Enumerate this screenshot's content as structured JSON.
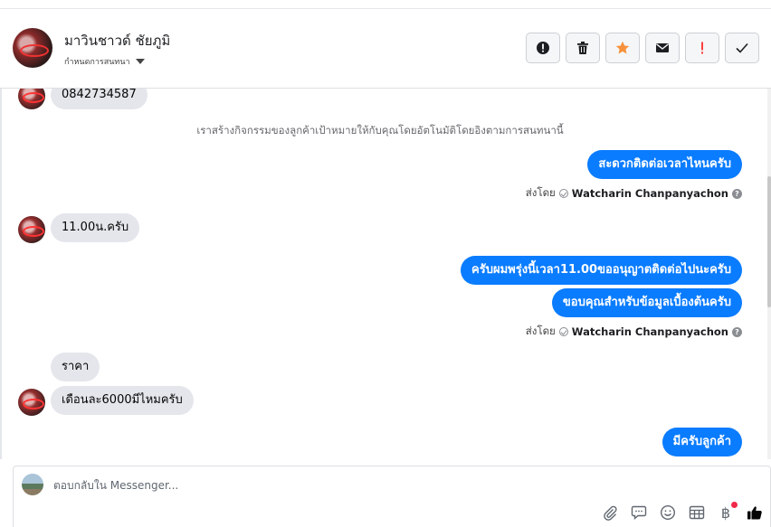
{
  "header": {
    "contact_name": "มาวินชาวด์ ชัยภูมิ",
    "status_label": "กำหนดการสนทนา",
    "actions": [
      {
        "name": "report-button",
        "icon": "exclamation-circle-icon"
      },
      {
        "name": "delete-button",
        "icon": "trash-icon"
      },
      {
        "name": "star-button",
        "icon": "star-icon",
        "color": "#f7923b"
      },
      {
        "name": "mail-button",
        "icon": "envelope-icon"
      },
      {
        "name": "priority-button",
        "icon": "exclamation-icon",
        "color": "#fa3e3e"
      },
      {
        "name": "done-button",
        "icon": "check-icon"
      }
    ]
  },
  "thread": {
    "msg_phone": "0842734587",
    "system_note": "เราสร้างกิจกรรมของลูกค้าเป้าหมายให้กับคุณโดยอัตโนมัติโดยอิงตามการสนทนานี้",
    "out_1": "สะดวกติดต่อเวลาไหนครับ",
    "sent_by_label": "ส่งโดย",
    "sender_name": "Watcharin Chanpanyachon",
    "in_time": "11.00น.ครับ",
    "out_2": "ครับผมพรุ่งนี้เวลา11.00ขออนุญาตติดต่อไปนะครับ",
    "out_3": "ขอบคุณสำหรับข้อมูลเบื้องต้นครับ",
    "in_price": "ราคา",
    "in_monthly": "เดือนละ6000มีไหมครับ",
    "out_4": "มีครับลูกค้า"
  },
  "composer": {
    "placeholder": "ตอบกลับใน Messenger...",
    "tools": [
      "paperclip-icon",
      "saved-reply-icon",
      "emoji-icon",
      "table-icon",
      "baht-payment-icon",
      "thumbs-up-icon"
    ],
    "baht_symbol": "฿"
  },
  "colors": {
    "outgoing_bubble": "#0a7cff",
    "incoming_bubble": "#e4e6eb",
    "like_icon": "#050505"
  }
}
